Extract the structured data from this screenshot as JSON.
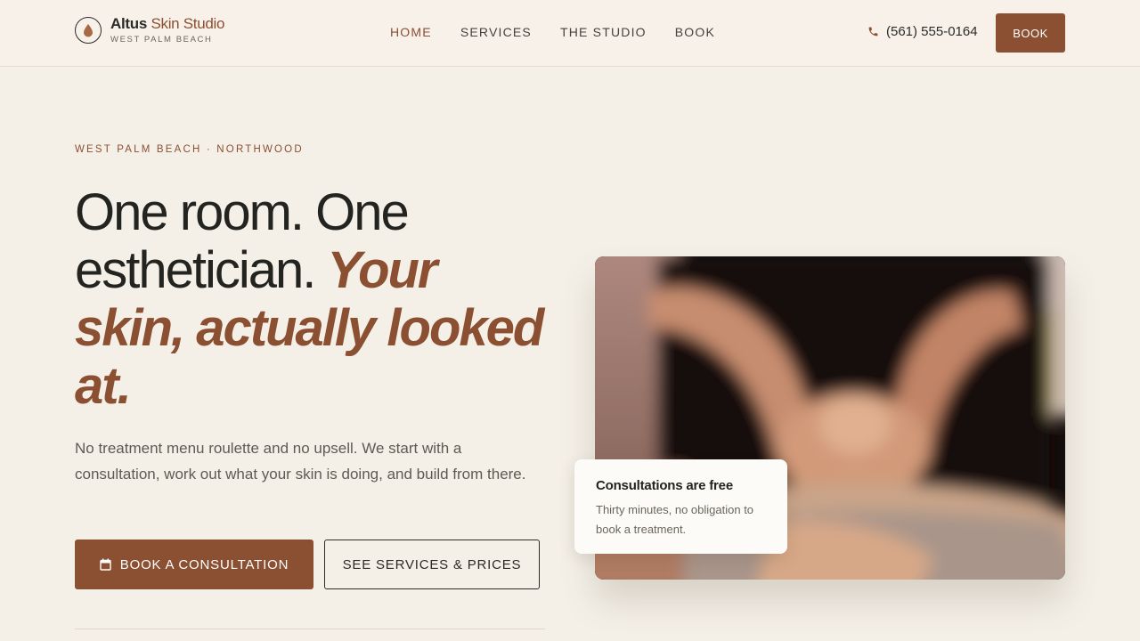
{
  "brand": {
    "name_bold": "Altus",
    "name_rest": "Skin Studio",
    "location": "WEST PALM BEACH",
    "logo_icon": "droplet-icon"
  },
  "nav": {
    "items": [
      {
        "label": "HOME",
        "active": true
      },
      {
        "label": "SERVICES",
        "active": false
      },
      {
        "label": "THE STUDIO",
        "active": false
      },
      {
        "label": "BOOK",
        "active": false
      }
    ],
    "phone": "(561) 555-0164",
    "phone_icon": "phone-icon",
    "book_label": "BOOK"
  },
  "hero": {
    "eyebrow": "WEST PALM BEACH · NORTHWOOD",
    "headline_plain": "One room. One esthetician.",
    "headline_accent": "Your skin, actually looked at.",
    "lead": "No treatment menu roulette and no upsell. We start with a consultation, work out what your skin is doing, and build from there.",
    "cta_primary": "BOOK A CONSULTATION",
    "cta_primary_icon": "calendar-icon",
    "cta_secondary": "SEE SERVICES & PRICES"
  },
  "card": {
    "title": "Consultations are free",
    "body": "Thirty minutes, no obligation to book a treatment."
  },
  "colors": {
    "accent": "#8b4f31",
    "background": "#f4f0e8",
    "header_bg": "#f7f1ea",
    "text": "#23231f"
  }
}
